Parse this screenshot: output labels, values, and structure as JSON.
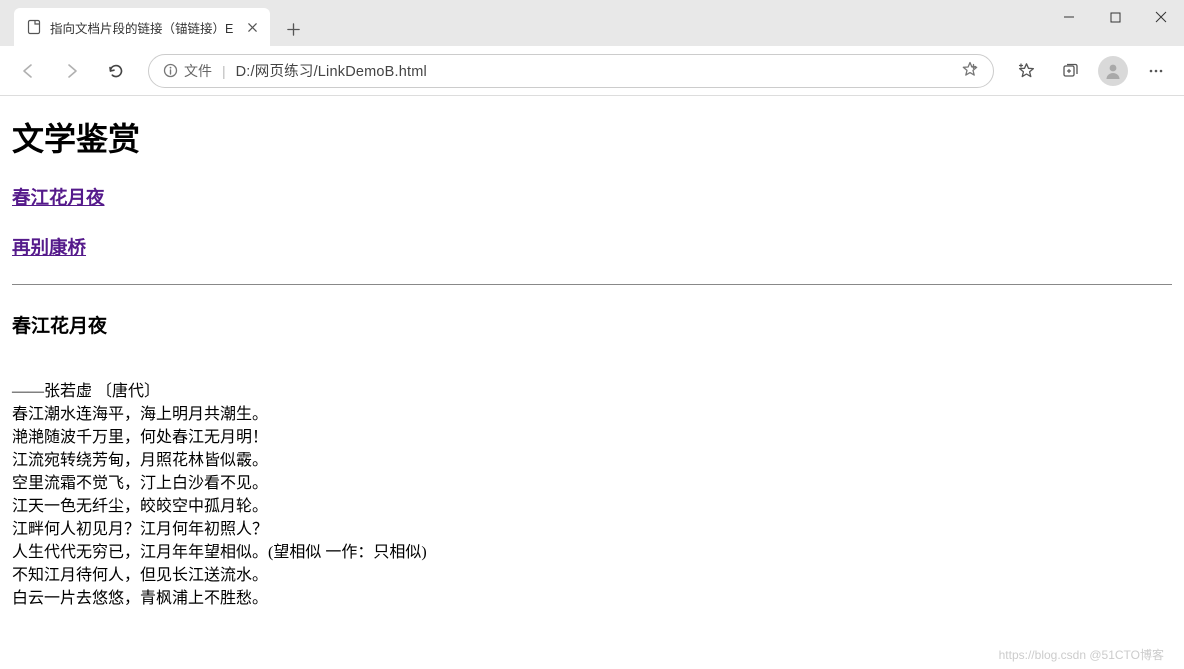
{
  "tab": {
    "title": "指向文档片段的链接（锚链接）E"
  },
  "addr": {
    "prefix": "文件",
    "path": "D:/网页练习/LinkDemoB.html"
  },
  "page": {
    "heading": "文学鉴赏",
    "link1": "春江花月夜",
    "link2": "再别康桥",
    "section_title": "春江花月夜",
    "poem_lines": [
      "——张若虚 〔唐代〕",
      "春江潮水连海平，海上明月共潮生。",
      "滟滟随波千万里，何处春江无月明！",
      "江流宛转绕芳甸，月照花林皆似霰。",
      "空里流霜不觉飞，汀上白沙看不见。",
      "江天一色无纤尘，皎皎空中孤月轮。",
      "江畔何人初见月？江月何年初照人？",
      "人生代代无穷已，江月年年望相似。(望相似 一作：只相似)",
      "不知江月待何人，但见长江送流水。",
      "白云一片去悠悠，青枫浦上不胜愁。"
    ]
  },
  "watermark": "https://blog.csdn @51CTO博客"
}
